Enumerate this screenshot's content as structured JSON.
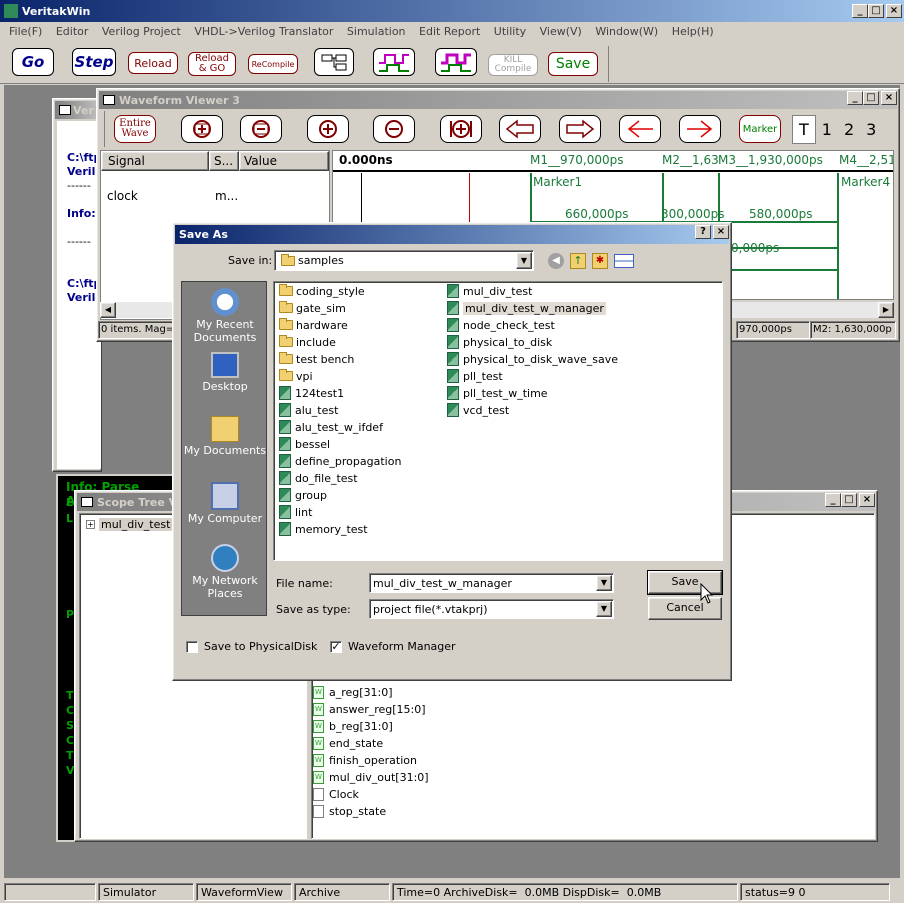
{
  "app": {
    "title": "VeritakWin",
    "menu": [
      "File(F)",
      "Editor",
      "Verilog Project",
      "VHDL->Verilog Translator",
      "Simulation",
      "Edit Report",
      "Utility",
      "View(V)",
      "Window(W)",
      "Help(H)"
    ],
    "toolbar": {
      "go": "Go",
      "step": "Step",
      "reload": "Reload",
      "reload_go_1": "Reload",
      "reload_go_2": "& GO",
      "recompile": "ReCompile",
      "kill_1": "KILL",
      "kill_2": "Compile",
      "save": "Save"
    }
  },
  "console_left": {
    "lines": [
      "C:\\ftp",
      "Verilo",
      "------",
      "Info: ",
      "------",
      "C:\\ftp",
      "Verilo"
    ]
  },
  "console_bottom": {
    "line1": "Info: Parse Analy",
    "letters": [
      "E",
      "L",
      "P",
      "T",
      "C",
      "S",
      "C",
      "T",
      "V"
    ]
  },
  "waveform": {
    "title": "Waveform Viewer 3",
    "buttons": {
      "entire_1": "Entire",
      "entire_2": "Wave",
      "marker": "Marker"
    },
    "tabs": [
      "T",
      "1",
      "2",
      "3"
    ],
    "columns": [
      "Signal",
      "S...",
      "Value"
    ],
    "signal_row": {
      "name": "clock",
      "value": "m..."
    },
    "time0": "0.000ns",
    "markers": {
      "m1": "M1__970,000ps",
      "m2": "M2__1,63",
      "m3": "M3__1,930,000ps",
      "m4": "M4__2,51"
    },
    "marker_labels": [
      "Marker1",
      "Marker4"
    ],
    "spans": [
      "660,000ps",
      "300,000ps",
      "580,000ps",
      "0,000ps"
    ],
    "status": {
      "items": "0 items. Mag=",
      "m1": "970,000ps",
      "m2": "M2: 1,630,000p"
    }
  },
  "scope_tree": {
    "title": "Scope Tree Vi",
    "root": "mul_div_test"
  },
  "signals": [
    {
      "name": "a_reg[31:0]",
      "kind": "wire"
    },
    {
      "name": "answer_reg[15:0]",
      "kind": "wire"
    },
    {
      "name": "b_reg[31:0]",
      "kind": "wire"
    },
    {
      "name": "end_state",
      "kind": "wire"
    },
    {
      "name": "finish_operation",
      "kind": "wire"
    },
    {
      "name": "mul_div_out[31:0]",
      "kind": "wire"
    },
    {
      "name": "Clock",
      "kind": "empty"
    },
    {
      "name": "stop_state",
      "kind": "empty"
    }
  ],
  "dialog": {
    "title": "Save As",
    "save_in_label": "Save in:",
    "save_in_value": "samples",
    "places": [
      "My Recent Documents",
      "Desktop",
      "My Documents",
      "My Computer",
      "My Network Places"
    ],
    "files_col1": [
      {
        "name": "coding_style",
        "type": "folder"
      },
      {
        "name": "gate_sim",
        "type": "folder"
      },
      {
        "name": "hardware",
        "type": "folder"
      },
      {
        "name": "include",
        "type": "folder"
      },
      {
        "name": "test bench",
        "type": "folder"
      },
      {
        "name": "vpi",
        "type": "folder"
      },
      {
        "name": "124test1",
        "type": "proj"
      },
      {
        "name": "alu_test",
        "type": "proj"
      },
      {
        "name": "alu_test_w_ifdef",
        "type": "proj"
      },
      {
        "name": "bessel",
        "type": "proj"
      },
      {
        "name": "define_propagation",
        "type": "proj"
      },
      {
        "name": "do_file_test",
        "type": "proj"
      },
      {
        "name": "group",
        "type": "proj"
      },
      {
        "name": "lint",
        "type": "proj"
      },
      {
        "name": "memory_test",
        "type": "proj"
      }
    ],
    "files_col2": [
      {
        "name": "mul_div_test",
        "type": "proj"
      },
      {
        "name": "mul_div_test_w_manager",
        "type": "proj",
        "selected": true
      },
      {
        "name": "node_check_test",
        "type": "proj"
      },
      {
        "name": "physical_to_disk",
        "type": "proj"
      },
      {
        "name": "physical_to_disk_wave_save",
        "type": "proj"
      },
      {
        "name": "pll_test",
        "type": "proj"
      },
      {
        "name": "pll_test_w_time",
        "type": "proj"
      },
      {
        "name": "vcd_test",
        "type": "proj"
      }
    ],
    "file_name_label": "File name:",
    "file_name_value": "mul_div_test_w_manager",
    "save_type_label": "Save as type:",
    "save_type_value": "project file(*.vtakprj)",
    "save_button": "Save",
    "cancel_button": "Cancel",
    "check_physical": {
      "label": "Save to PhysicalDisk",
      "checked": false
    },
    "check_waveform": {
      "label": "Waveform Manager",
      "checked": true
    }
  },
  "statusbar": [
    "Simulator",
    "WaveformView",
    "Archive",
    "Time=0 ArchiveDisk=  0.0MB DispDisk=  0.0MB",
    "status=9 0"
  ],
  "colors": {
    "titlebar": "#0a246a",
    "waveform_green": "#1a7a3a",
    "console_bg": "#000000",
    "console_green": "#00a000",
    "marker_red": "#800000"
  }
}
